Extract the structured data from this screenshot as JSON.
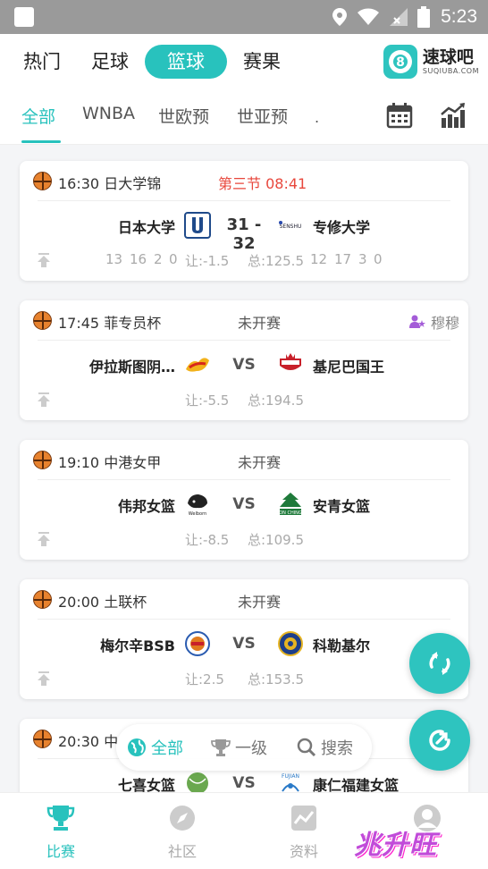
{
  "status_bar": {
    "time": "5:23"
  },
  "top_tabs": [
    "热门",
    "足球",
    "篮球",
    "赛果"
  ],
  "top_tab_active": "篮球",
  "brand": {
    "name": "速球吧",
    "domain": "SUQIUBA.COM"
  },
  "sub_tabs": [
    "全部",
    "WNBA",
    "世欧预",
    "世亚预"
  ],
  "sub_tab_active": "全部",
  "sub_tab_more": ".",
  "matches": [
    {
      "time_league": "16:30 日大学锦",
      "status": "第三节  08:41",
      "home": "日本大学",
      "away": "专修大学",
      "score": "31 - 32",
      "odds": [
        "13",
        "16",
        "2",
        "0",
        "让:-1.5",
        "总:125.5",
        "12",
        "17",
        "3",
        "0"
      ]
    },
    {
      "time_league": "17:45 菲专员杯",
      "status": "未开赛",
      "tipster": "穆穆",
      "home": "伊拉斯图阴…",
      "away": "基尼巴国王",
      "vs": "VS",
      "odds": [
        "让:-5.5",
        "总:194.5"
      ]
    },
    {
      "time_league": "19:10 中港女甲",
      "status": "未开赛",
      "home": "伟邦女篮",
      "away": "安青女篮",
      "vs": "VS",
      "odds": [
        "让:-8.5",
        "总:109.5"
      ]
    },
    {
      "time_league": "20:00 土联杯",
      "status": "未开赛",
      "home": "梅尔辛BSB",
      "away": "科勒基尔",
      "vs": "VS",
      "odds": [
        "让:2.5",
        "总:153.5"
      ]
    },
    {
      "time_league": "20:30 中",
      "home": "七喜女篮",
      "away": "康仁福建女篮",
      "vs": "VS"
    }
  ],
  "filter": {
    "all": "全部",
    "level1": "一级",
    "search": "搜索"
  },
  "bottom_nav": [
    "比赛",
    "社区",
    "资料",
    ""
  ],
  "bottom_nav_active": "比赛",
  "watermark": "兆升旺",
  "colors": {
    "accent": "#28c2bd",
    "live": "#e8473c",
    "muted": "#aaaaaa"
  }
}
